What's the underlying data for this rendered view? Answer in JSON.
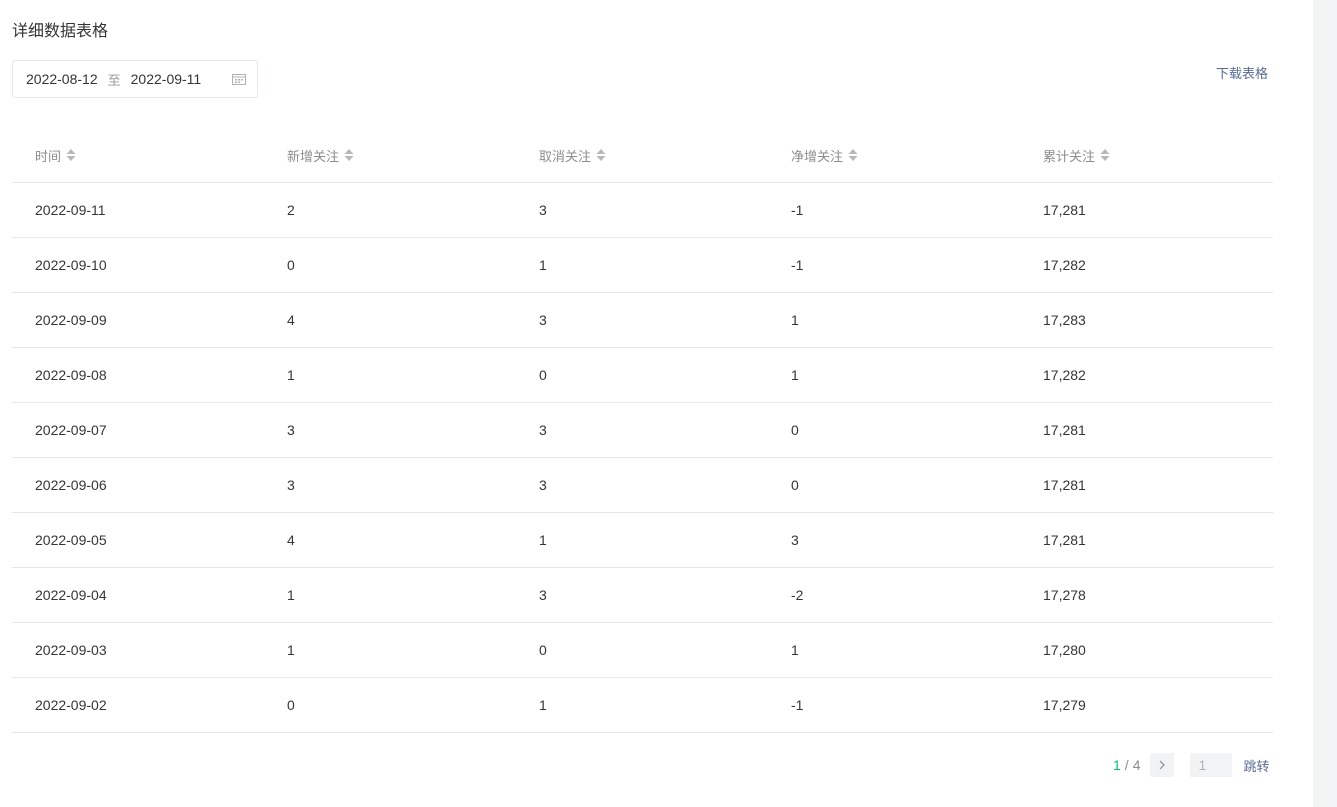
{
  "title": "详细数据表格",
  "date_range": {
    "start": "2022-08-12",
    "separator": "至",
    "end": "2022-09-11"
  },
  "download_label": "下载表格",
  "table": {
    "headers": [
      "时间",
      "新增关注",
      "取消关注",
      "净增关注",
      "累计关注"
    ],
    "rows": [
      [
        "2022-09-11",
        "2",
        "3",
        "-1",
        "17,281"
      ],
      [
        "2022-09-10",
        "0",
        "1",
        "-1",
        "17,282"
      ],
      [
        "2022-09-09",
        "4",
        "3",
        "1",
        "17,283"
      ],
      [
        "2022-09-08",
        "1",
        "0",
        "1",
        "17,282"
      ],
      [
        "2022-09-07",
        "3",
        "3",
        "0",
        "17,281"
      ],
      [
        "2022-09-06",
        "3",
        "3",
        "0",
        "17,281"
      ],
      [
        "2022-09-05",
        "4",
        "1",
        "3",
        "17,281"
      ],
      [
        "2022-09-04",
        "1",
        "3",
        "-2",
        "17,278"
      ],
      [
        "2022-09-03",
        "1",
        "0",
        "1",
        "17,280"
      ],
      [
        "2022-09-02",
        "0",
        "1",
        "-1",
        "17,279"
      ]
    ]
  },
  "pagination": {
    "current": "1",
    "separator": "/",
    "total": "4",
    "jump_value": "1",
    "jump_label": "跳转"
  },
  "icons": {
    "calendar": "calendar-icon",
    "sort": "sort-icon",
    "next": "chevron-right-icon"
  },
  "colors": {
    "accent": "#07c160",
    "link": "#576b95"
  }
}
